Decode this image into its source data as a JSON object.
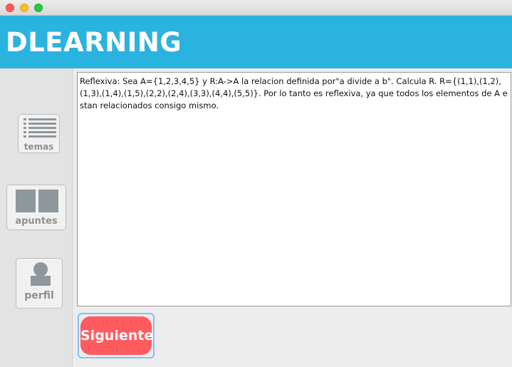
{
  "window": {
    "controls": [
      "close",
      "minimize",
      "zoom"
    ]
  },
  "header": {
    "title": "DLEARNING",
    "color": "#2bb3e0"
  },
  "sidebar": {
    "items": [
      {
        "label": "temas",
        "icon": "list-icon"
      },
      {
        "label": "apuntes",
        "icon": "book-icon"
      },
      {
        "label": "perfil",
        "icon": "user-icon"
      }
    ]
  },
  "main": {
    "text": "Reflexiva: Sea A={1,2,3,4,5} y R:A->A la relacion definida por\"a divide a b\". Calcula R. R={(1,1),(1,2),(1,3),(1,4),(1,5),(2,2),(2,4),(3,3),(4,4),(5,5)}. Por lo tanto es reflexiva, ya que todos los elementos de A estan relacionados consigo mismo.",
    "next_label": "Siguiente",
    "next_color": "#ff5a5f"
  }
}
